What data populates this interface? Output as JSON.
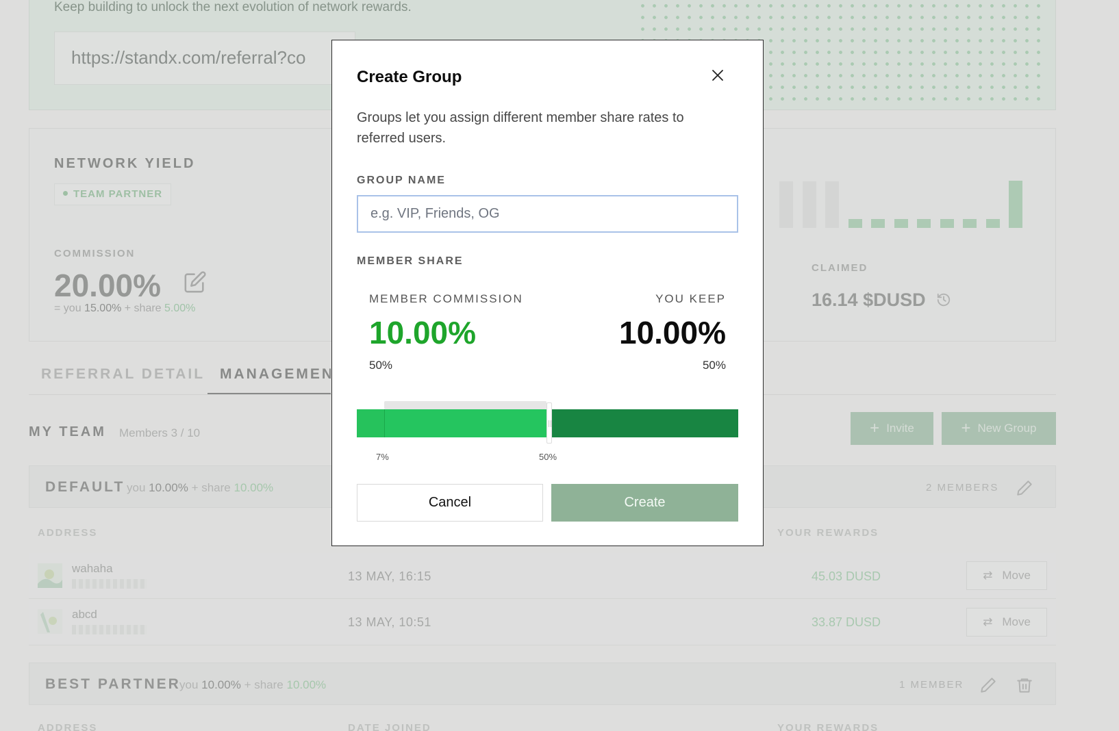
{
  "referral": {
    "tagline": "Keep building to unlock the next evolution of network rewards.",
    "link_value": "https://standx.com/referral?co"
  },
  "yield": {
    "title": "NETWORK YIELD",
    "badge": "TEAM PARTNER",
    "commission_label": "COMMISSION",
    "commission_value": "20.00%",
    "breakdown_prefix": "= you",
    "breakdown_you": "15.00%",
    "breakdown_mid": "+ share",
    "breakdown_share": "5.00%",
    "claimed_label": "CLAIMED",
    "claimed_value": "16.14 $DUSD",
    "bars": [
      {
        "level": 0.9,
        "active": false
      },
      {
        "level": 0.9,
        "active": false
      },
      {
        "level": 0.9,
        "active": false
      },
      {
        "level": 0.17,
        "active": true
      },
      {
        "level": 0.17,
        "active": true
      },
      {
        "level": 0.17,
        "active": true
      },
      {
        "level": 0.17,
        "active": true
      },
      {
        "level": 0.17,
        "active": true
      },
      {
        "level": 0.17,
        "active": true
      },
      {
        "level": 0.17,
        "active": true
      },
      {
        "level": 0.92,
        "active": true
      }
    ]
  },
  "tabs": {
    "referral_detail": "REFERRAL DETAIL",
    "management": "MANAGEMENT"
  },
  "team": {
    "title": "MY TEAM",
    "members_count": "Members 3 / 10",
    "invite_label": "Invite",
    "new_group_label": "New Group"
  },
  "groups": [
    {
      "name": "DEFAULT",
      "you_prefix": "you",
      "you": "10.00%",
      "share_prefix": "+ share",
      "share": "10.00%",
      "members_label": "2 MEMBERS",
      "columns": {
        "address": "ADDRESS",
        "rewards": "YOUR REWARDS"
      },
      "rows": [
        {
          "name": "wahaha",
          "date": "13 MAY, 16:15",
          "reward": "45.03 DUSD",
          "action": "Move"
        },
        {
          "name": "abcd",
          "date": "13 MAY, 10:51",
          "reward": "33.87 DUSD",
          "action": "Move"
        }
      ]
    },
    {
      "name": "BEST PARTNER",
      "you_prefix": "you",
      "you": "10.00%",
      "share_prefix": "+ share",
      "share": "10.00%",
      "members_label": "1 MEMBER",
      "columns": {
        "address": "ADDRESS",
        "date_joined": "DATE JOINED",
        "rewards": "YOUR REWARDS"
      }
    }
  ],
  "modal": {
    "title": "Create Group",
    "description": "Groups let you assign different member share rates to referred users.",
    "group_name_label": "GROUP NAME",
    "group_name_placeholder": "e.g. VIP, Friends, OG",
    "member_share_label": "MEMBER SHARE",
    "member_commission_label": "MEMBER COMMISSION",
    "member_commission_value": "10.00%",
    "member_commission_pct": "50%",
    "you_keep_label": "YOU KEEP",
    "you_keep_value": "10.00%",
    "you_keep_pct": "50%",
    "slider": {
      "min_tick": "7%",
      "value_tick": "50%",
      "min_percent": 7,
      "value_percent": 50
    },
    "cancel_label": "Cancel",
    "create_label": "Create"
  },
  "colors": {
    "accent_green": "#1ea52b",
    "slider_light": "#25c55f",
    "slider_dark": "#188542",
    "create_button": "#8fb297",
    "input_focus": "#a9c2e8"
  }
}
